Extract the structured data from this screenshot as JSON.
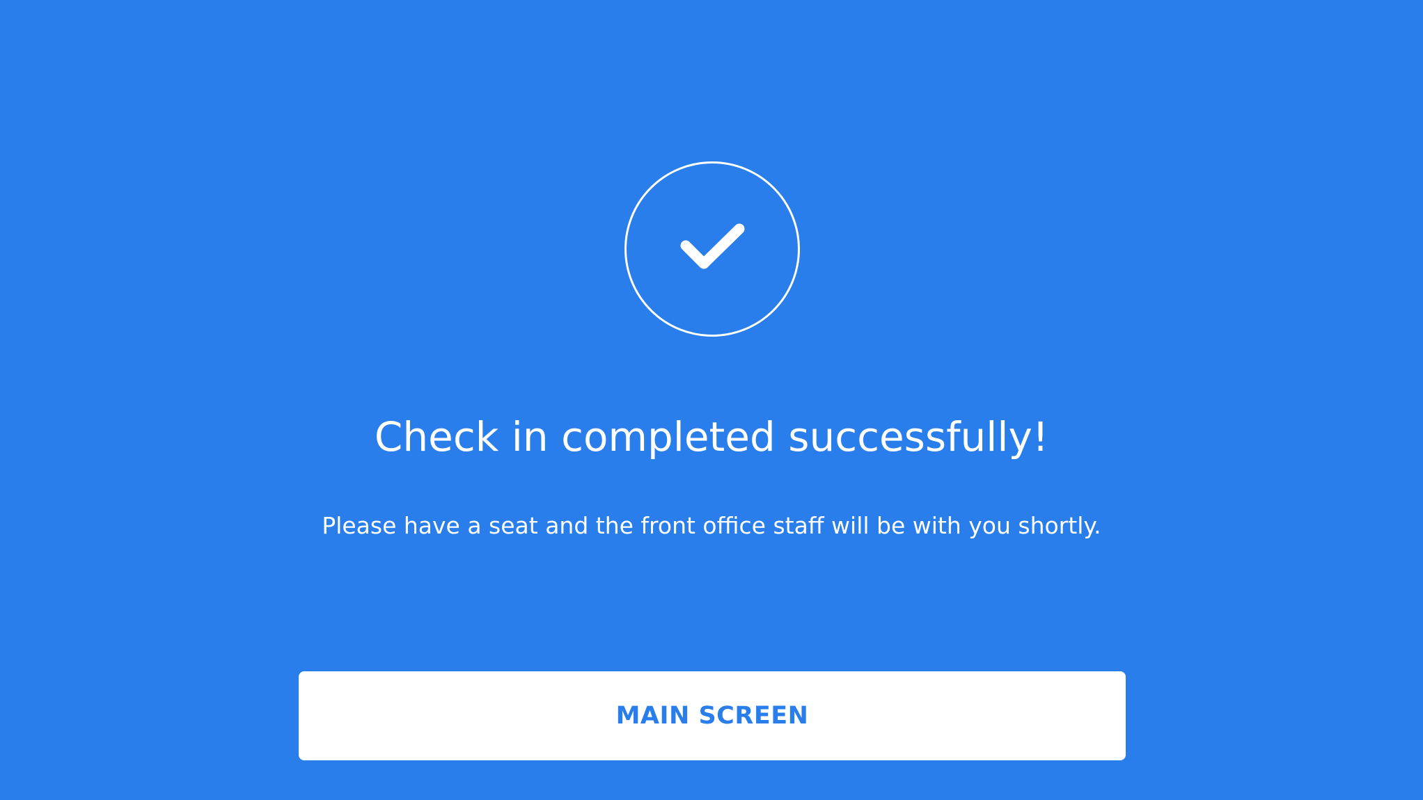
{
  "theme": {
    "background": "#2a7eec",
    "foreground": "#ffffff",
    "button_text": "#2a7eec"
  },
  "icon": "check-circle-icon",
  "title": "Check in completed successfully!",
  "message": "Please have a seat and the front office staff will be with you shortly.",
  "button": {
    "label": "MAIN SCREEN"
  }
}
